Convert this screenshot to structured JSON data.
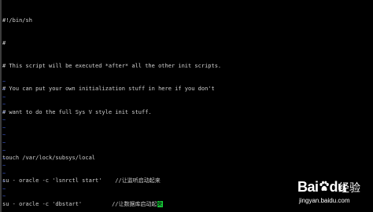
{
  "terminal": {
    "lines": [
      "#!/bin/sh",
      "#",
      "# This script will be executed *after* all the other init scripts.",
      "# You can put your own initialization stuff in here if you don't",
      "# want to do the full Sys V style init stuff.",
      "",
      "touch /var/lock/subsys/local",
      "su - oracle -c 'lsnrctl start'    //让监听启动起来",
      "su - oracle -c 'dbstart'         //让数据库启动起"
    ],
    "cursor_char": "来",
    "tilde": "~"
  },
  "watermark": {
    "logo_left": "Bai",
    "logo_right": "du",
    "logo_cn": "经验",
    "url": "jingyan.baidu.com"
  },
  "colors": {
    "background": "#000000",
    "text": "#d0d0d0",
    "tilde": "#3a55c8",
    "cursor": "#17d23a"
  }
}
